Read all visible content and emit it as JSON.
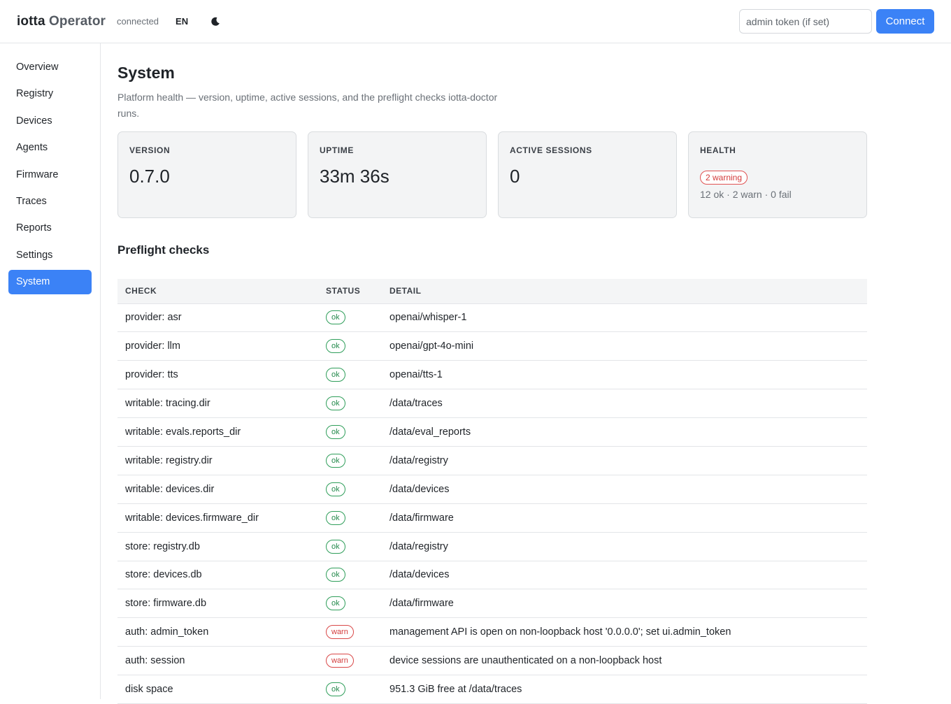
{
  "header": {
    "brand_main": "iotta",
    "brand_sub": "Operator",
    "connection_status": "connected",
    "language": "EN",
    "theme_icon": "moon-icon",
    "token_placeholder": "admin token (if set)",
    "token_value": "",
    "connect_label": "Connect",
    "accent_color": "#3b82f6"
  },
  "sidebar": {
    "items": [
      {
        "label": "Overview",
        "active": false
      },
      {
        "label": "Registry",
        "active": false
      },
      {
        "label": "Devices",
        "active": false
      },
      {
        "label": "Agents",
        "active": false
      },
      {
        "label": "Firmware",
        "active": false
      },
      {
        "label": "Traces",
        "active": false
      },
      {
        "label": "Reports",
        "active": false
      },
      {
        "label": "Settings",
        "active": false
      },
      {
        "label": "System",
        "active": true
      }
    ]
  },
  "main": {
    "title": "System",
    "description": "Platform health — version, uptime, active sessions, and the preflight checks iotta-doctor runs.",
    "cards": {
      "version": {
        "label": "VERSION",
        "value": "0.7.0"
      },
      "uptime": {
        "label": "UPTIME",
        "value": "33m 36s"
      },
      "sessions": {
        "label": "ACTIVE SESSIONS",
        "value": "0"
      },
      "health": {
        "label": "HEALTH",
        "badge": "2 warning",
        "summary": "12 ok · 2 warn · 0 fail"
      }
    },
    "preflight_title": "Preflight checks",
    "table": {
      "headers": {
        "check": "CHECK",
        "status": "STATUS",
        "detail": "DETAIL"
      },
      "rows": [
        {
          "check": "provider: asr",
          "status": "ok",
          "detail": "openai/whisper-1"
        },
        {
          "check": "provider: llm",
          "status": "ok",
          "detail": "openai/gpt-4o-mini"
        },
        {
          "check": "provider: tts",
          "status": "ok",
          "detail": "openai/tts-1"
        },
        {
          "check": "writable: tracing.dir",
          "status": "ok",
          "detail": "/data/traces"
        },
        {
          "check": "writable: evals.reports_dir",
          "status": "ok",
          "detail": "/data/eval_reports"
        },
        {
          "check": "writable: registry.dir",
          "status": "ok",
          "detail": "/data/registry"
        },
        {
          "check": "writable: devices.dir",
          "status": "ok",
          "detail": "/data/devices"
        },
        {
          "check": "writable: devices.firmware_dir",
          "status": "ok",
          "detail": "/data/firmware"
        },
        {
          "check": "store: registry.db",
          "status": "ok",
          "detail": "/data/registry"
        },
        {
          "check": "store: devices.db",
          "status": "ok",
          "detail": "/data/devices"
        },
        {
          "check": "store: firmware.db",
          "status": "ok",
          "detail": "/data/firmware"
        },
        {
          "check": "auth: admin_token",
          "status": "warn",
          "detail": "management API is open on non-loopback host '0.0.0.0'; set ui.admin_token"
        },
        {
          "check": "auth: session",
          "status": "warn",
          "detail": "device sessions are unauthenticated on a non-loopback host"
        },
        {
          "check": "disk space",
          "status": "ok",
          "detail": "951.3 GiB free at /data/traces"
        }
      ]
    }
  }
}
